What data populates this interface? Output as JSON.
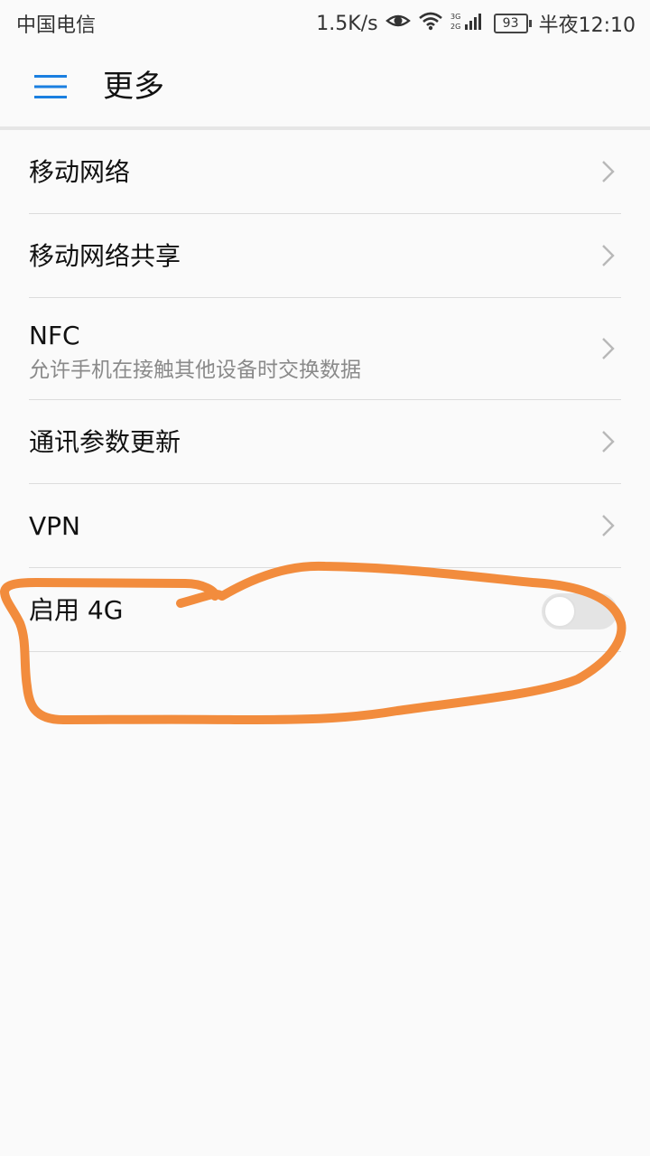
{
  "status_bar": {
    "carrier": "中国电信",
    "speed": "1.5K/s",
    "battery": "93",
    "time": "半夜12:10",
    "icons": [
      "eye-icon",
      "wifi-icon",
      "signal-icon"
    ]
  },
  "app_bar": {
    "title": "更多",
    "menu_icon": "hamburger-menu-icon"
  },
  "items": [
    {
      "title": "移动网络"
    },
    {
      "title": "移动网络共享"
    },
    {
      "title": "NFC",
      "subtitle": "允许手机在接触其他设备时交换数据"
    },
    {
      "title": "通讯参数更新"
    },
    {
      "title": "VPN"
    },
    {
      "title": "启用 4G",
      "toggle": false
    }
  ],
  "colors": {
    "accent": "#1a7fe0",
    "annotation": "#f28c3d",
    "background": "#fafafa"
  }
}
